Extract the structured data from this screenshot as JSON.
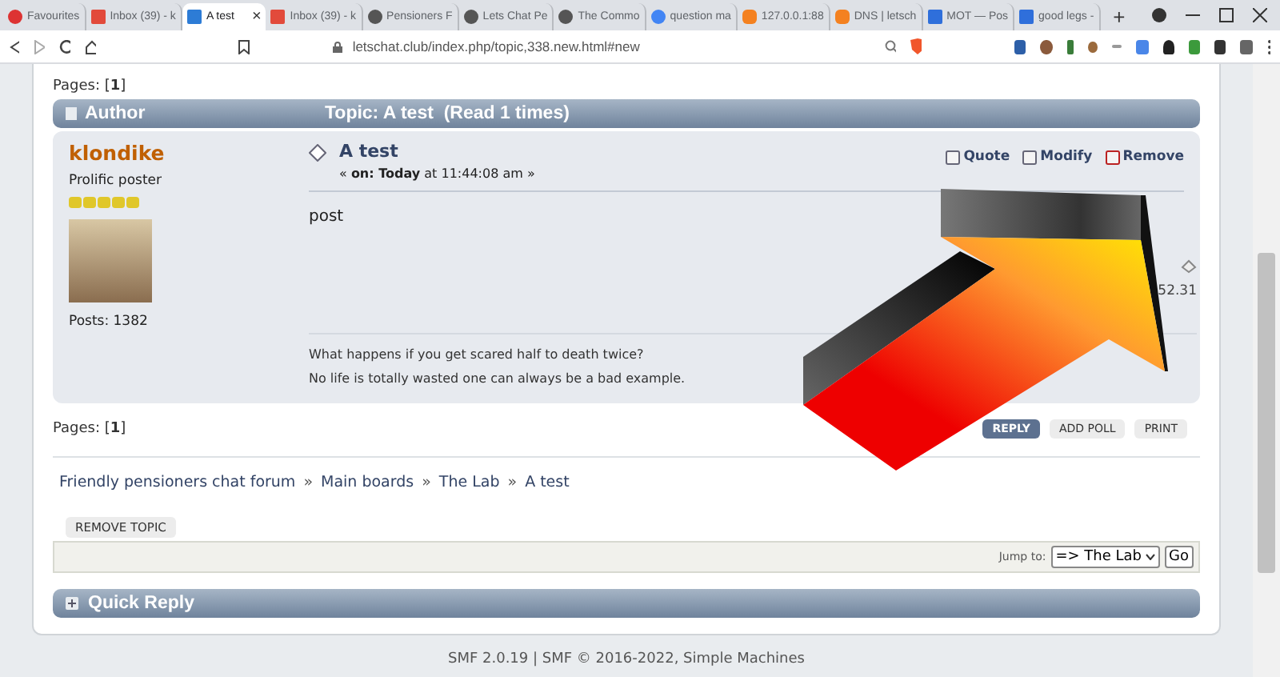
{
  "browser": {
    "tabs": [
      {
        "kind": "heart",
        "label": "Favourites",
        "selected": false
      },
      {
        "kind": "mail",
        "label": "Inbox (39) - k",
        "selected": false
      },
      {
        "kind": "forum",
        "label": "A test",
        "selected": true
      },
      {
        "kind": "mail",
        "label": "Inbox (39) - k",
        "selected": false
      },
      {
        "kind": "globe",
        "label": "Pensioners F",
        "selected": false
      },
      {
        "kind": "globe",
        "label": "Lets Chat Pe",
        "selected": false
      },
      {
        "kind": "globe",
        "label": "The Commo",
        "selected": false
      },
      {
        "kind": "search",
        "label": "question ma",
        "selected": false
      },
      {
        "kind": "cloud",
        "label": "127.0.0.1:88",
        "selected": false
      },
      {
        "kind": "cloud",
        "label": "DNS | letsch",
        "selected": false
      },
      {
        "kind": "letter",
        "label": "MOT — Pos",
        "selected": false
      },
      {
        "kind": "letter",
        "label": "good legs -",
        "selected": false
      }
    ],
    "new_tab": "+",
    "close_tab": "×",
    "url": "letschat.club/index.php/topic,338.new.html#new"
  },
  "page": {
    "pages_top": "Pages: [**1**]",
    "header": {
      "author": "Author",
      "topic": "Topic: A test  (Read 1 times)"
    },
    "post": {
      "author": "klondike",
      "rank": "Prolific poster",
      "stars": 5,
      "posts": "Posts: 1382",
      "title": "A test",
      "date": "« **on: Today** at 11:44:08 am »",
      "actions": [
        "Quote",
        "Modify",
        "Remove"
      ],
      "body": "post",
      "ip": "52.31",
      "signature": [
        "What happens if you get scared half to death twice?",
        "No life is totally wasted one can always be a bad example."
      ]
    },
    "buttons": [
      {
        "label": "REPLY",
        "primary": true
      },
      {
        "label": "ADD POLL",
        "primary": false
      },
      {
        "label": "PRINT",
        "primary": false
      }
    ],
    "pages_bottom": "Pages: [**1**]",
    "separator": "»",
    "breadcrumb": [
      "Friendly pensioners chat forum",
      "Main boards",
      "The Lab",
      "A test"
    ],
    "remove_topic": "REMOVE TOPIC",
    "jump_label": "Jump to:",
    "jump_value": "=> The Lab",
    "go": "Go",
    "quick_reply": "Quick Reply",
    "footer": "SMF 2.0.19 | SMF © 2016-2022, Simple Machines"
  }
}
